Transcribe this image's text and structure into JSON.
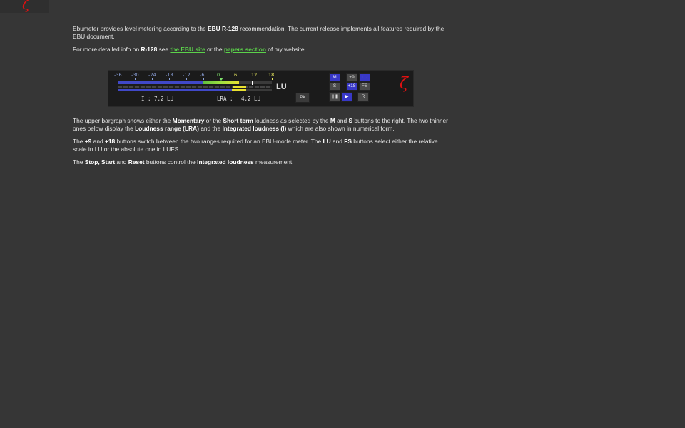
{
  "logo": {
    "glyph": "ζ"
  },
  "intro": {
    "p1_a": "Ebumeter provides level metering according to the ",
    "p1_b": "EBU R-128",
    "p1_c": " recommendation. The current release implements all features required by the EBU document.",
    "p2_a": "For more detailed info on ",
    "p2_b": "R-128",
    "p2_c": " see ",
    "link_ebu": "the EBU site",
    "p2_d": " or the ",
    "link_papers": "papers section",
    "p2_e": " of my website."
  },
  "meter": {
    "scale_labels": [
      "-36",
      "-30",
      "-24",
      "-18",
      "-12",
      "-6",
      "0",
      "6",
      "12",
      "18"
    ],
    "scale_colors": [
      "#8a9fd8",
      "#8a9fd8",
      "#8a9fd8",
      "#8a9fd8",
      "#8a9fd8",
      "#8a9fd8",
      "#7ee06a",
      "#e8e860",
      "#e8e860",
      "#e8e860"
    ],
    "integrated_label": "I :",
    "integrated_value": "7.2 LU",
    "lra_label": "LRA :",
    "lra_value": "4.2 LU",
    "unit_label": "LU",
    "buttons": {
      "m": "M",
      "s": "S",
      "plus9": "+9",
      "plus18": "+18",
      "lu": "LU",
      "fs": "FS",
      "pk": "Pk",
      "stop": "❚❚",
      "start": "▶",
      "reset": "R"
    },
    "logo_glyph": "ζ"
  },
  "body": {
    "p3_a": "The upper bargraph shows either the ",
    "p3_b": "Momentary",
    "p3_c": " or the ",
    "p3_d": "Short term",
    "p3_e": " loudness as selected by the ",
    "p3_f": "M",
    "p3_g": " and ",
    "p3_h": "S",
    "p3_i": " buttons to the right. The two thinner ones below display the ",
    "p3_j": "Loudness range (LRA)",
    "p3_k": " and the ",
    "p3_l": "Integrated loudness (I)",
    "p3_m": " which are also shown in numerical form.",
    "p4_a": "The ",
    "p4_b": "+9",
    "p4_c": " and ",
    "p4_d": "+18",
    "p4_e": " buttons switch between the two ranges required for an EBU-mode meter. The ",
    "p4_f": "LU",
    "p4_g": " and ",
    "p4_h": "FS",
    "p4_i": " buttons select either the relative scale in LU or the absolute one in LUFS.",
    "p5_a": "The ",
    "p5_b": "Stop, Start",
    "p5_c": " and ",
    "p5_d": "Reset",
    "p5_e": " buttons control the ",
    "p5_f": "Integrated loudness",
    "p5_g": " measurement."
  }
}
